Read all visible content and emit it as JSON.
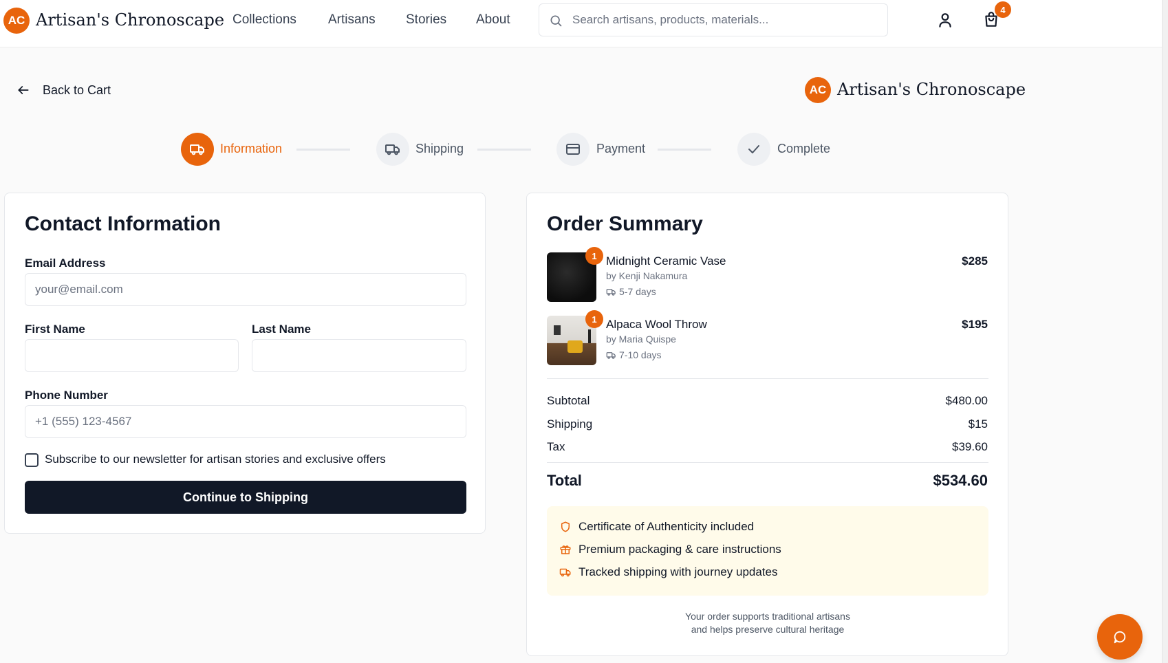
{
  "brand": {
    "initials": "AC",
    "name": "Artisan's Chronoscape"
  },
  "nav": [
    "Collections",
    "Artisans",
    "Stories",
    "About"
  ],
  "search": {
    "placeholder": "Search artisans, products, materials..."
  },
  "header_icons": {
    "account": "user-icon",
    "cart": "shopping-bag-icon",
    "cart_count": "4"
  },
  "back": {
    "label": "Back to Cart",
    "icon": "arrow-left-icon"
  },
  "steps": [
    {
      "label": "Information",
      "icon": "truck-icon",
      "active": true
    },
    {
      "label": "Shipping",
      "icon": "truck-icon",
      "active": false
    },
    {
      "label": "Payment",
      "icon": "credit-card-icon",
      "active": false
    },
    {
      "label": "Complete",
      "icon": "check-icon",
      "active": false
    }
  ],
  "contact": {
    "title": "Contact Information",
    "email": {
      "label": "Email Address",
      "placeholder": "your@email.com",
      "value": ""
    },
    "first_name": {
      "label": "First Name",
      "placeholder": "",
      "value": ""
    },
    "last_name": {
      "label": "Last Name",
      "placeholder": "",
      "value": ""
    },
    "phone": {
      "label": "Phone Number",
      "placeholder": "+1 (555) 123-4567",
      "value": ""
    },
    "newsletter": {
      "label": "Subscribe to our newsletter for artisan stories and exclusive offers",
      "checked": false
    },
    "submit": "Continue to Shipping"
  },
  "summary": {
    "title": "Order Summary",
    "items": [
      {
        "qty": "1",
        "name": "Midnight Ceramic Vase",
        "artisan": "by Kenji Nakamura",
        "eta": "5-7 days",
        "price": "$285"
      },
      {
        "qty": "1",
        "name": "Alpaca Wool Throw",
        "artisan": "by Maria Quispe",
        "eta": "7-10 days",
        "price": "$195"
      }
    ],
    "subtotal": {
      "label": "Subtotal",
      "value": "$480.00"
    },
    "shipping": {
      "label": "Shipping",
      "value": "$15"
    },
    "tax": {
      "label": "Tax",
      "value": "$39.60"
    },
    "total": {
      "label": "Total",
      "value": "$534.60"
    },
    "perks": [
      {
        "icon": "shield-icon",
        "text": "Certificate of Authenticity included"
      },
      {
        "icon": "gift-icon",
        "text": "Premium packaging & care instructions"
      },
      {
        "icon": "truck-icon",
        "text": "Tracked shipping with journey updates"
      }
    ],
    "support_line1": "Your order supports traditional artisans",
    "support_line2": "and helps preserve cultural heritage"
  },
  "chat": {
    "icon": "chat-bubble-icon"
  },
  "colors": {
    "accent": "#e8640c",
    "primary_button": "#111827",
    "perks_bg": "#fffbea"
  }
}
